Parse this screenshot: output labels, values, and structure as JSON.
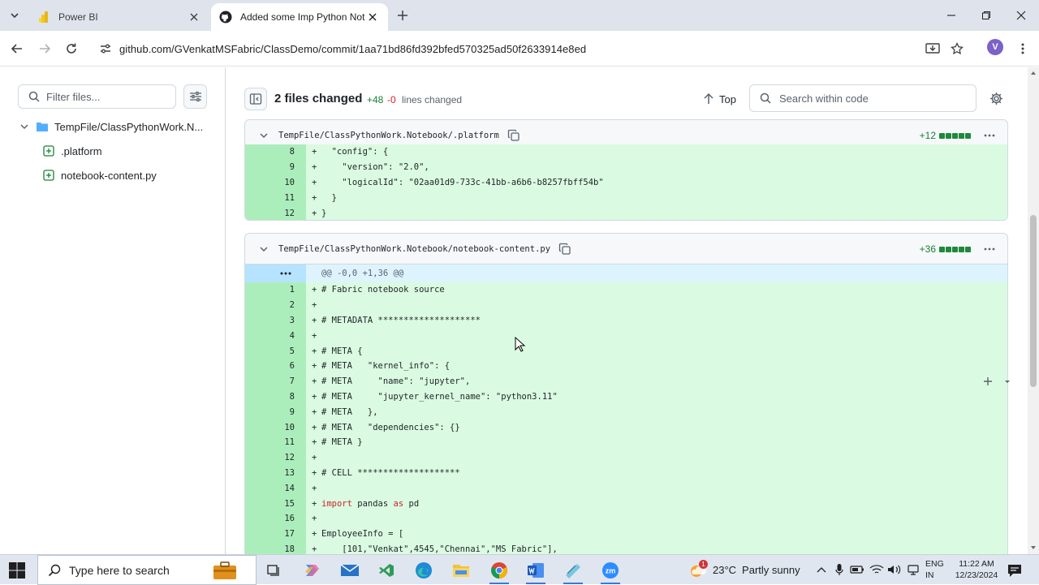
{
  "browser": {
    "tabs": [
      {
        "title": "Power BI",
        "active": false
      },
      {
        "title": "Added some Imp Python Notebook",
        "active": true
      }
    ],
    "url": "github.com/GVenkatMSFabric/ClassDemo/commit/1aa71bd86fd392bfed570325ad50f2633914e8ed",
    "profile_initial": "V"
  },
  "sidebar": {
    "filter_placeholder": "Filter files...",
    "tree": {
      "folder": "TempFile/ClassPythonWork.N...",
      "files": [
        ".platform",
        "notebook-content.py"
      ]
    }
  },
  "summary": {
    "title": "2 files changed",
    "additions": "+48",
    "deletions": "-0",
    "lines_label": "lines changed",
    "top_label": "Top",
    "search_placeholder": "Search within code"
  },
  "files": [
    {
      "path": "TempFile/ClassPythonWork.Notebook/.platform",
      "stat": "+12",
      "lines": [
        {
          "n": "8",
          "text": "  \"config\": {"
        },
        {
          "n": "9",
          "text": "    \"version\": \"2.0\","
        },
        {
          "n": "10",
          "text": "    \"logicalId\": \"02aa01d9-733c-41bb-a6b6-b8257fbff54b\""
        },
        {
          "n": "11",
          "text": "  }"
        },
        {
          "n": "12",
          "text": "}"
        }
      ]
    },
    {
      "path": "TempFile/ClassPythonWork.Notebook/notebook-content.py",
      "stat": "+36",
      "hunk": "@@ -0,0 +1,36 @@",
      "lines": [
        {
          "n": "1",
          "text": "# Fabric notebook source"
        },
        {
          "n": "2",
          "text": ""
        },
        {
          "n": "3",
          "text": "# METADATA ********************"
        },
        {
          "n": "4",
          "text": ""
        },
        {
          "n": "5",
          "text": "# META {"
        },
        {
          "n": "6",
          "text": "# META   \"kernel_info\": {"
        },
        {
          "n": "7",
          "text": "# META     \"name\": \"jupyter\","
        },
        {
          "n": "8",
          "text": "# META     \"jupyter_kernel_name\": \"python3.11\""
        },
        {
          "n": "9",
          "text": "# META   },"
        },
        {
          "n": "10",
          "text": "# META   \"dependencies\": {}"
        },
        {
          "n": "11",
          "text": "# META }"
        },
        {
          "n": "12",
          "text": ""
        },
        {
          "n": "13",
          "text": "# CELL ********************"
        },
        {
          "n": "14",
          "text": ""
        },
        {
          "n": "15",
          "text": "import pandas as pd"
        },
        {
          "n": "16",
          "text": ""
        },
        {
          "n": "17",
          "text": "EmployeeInfo = ["
        },
        {
          "n": "18",
          "text": "    [101,\"Venkat\",4545,\"Chennai\",\"MS Fabric\"],"
        }
      ]
    }
  ],
  "taskbar": {
    "search_placeholder": "Type here to search",
    "weather_temp": "23°C",
    "weather_text": "Partly sunny",
    "weather_badge": "1",
    "lang_line1": "ENG",
    "lang_line2": "IN",
    "time": "11:22 AM",
    "date": "12/23/2024"
  },
  "colors": {
    "added_bg": "#dafbe1",
    "added_gutter": "#aceebb",
    "hunk_bg": "#ddf4ff",
    "diffstat_green": "#1f883d",
    "additions_text": "#1a7f37",
    "deletions_text": "#d1242f"
  }
}
